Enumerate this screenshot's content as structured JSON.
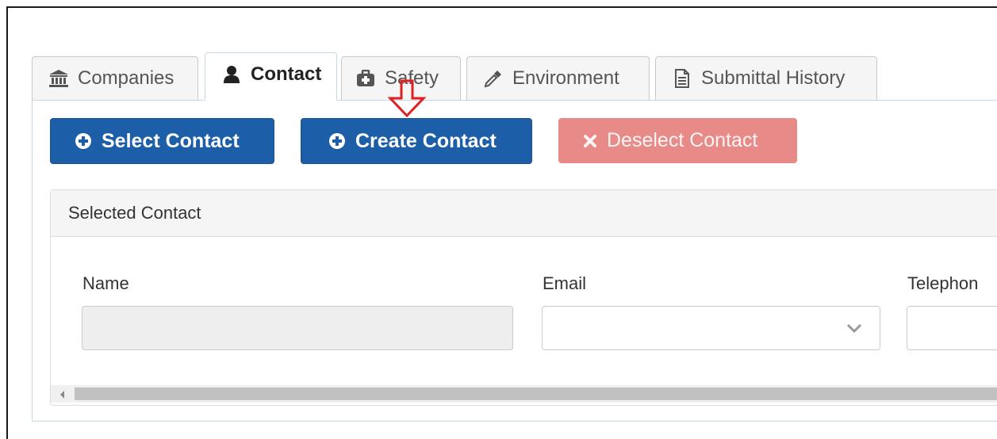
{
  "tabs": [
    {
      "label": "Companies",
      "icon": "bank-icon",
      "active": false
    },
    {
      "label": "Contact",
      "icon": "user-icon",
      "active": true
    },
    {
      "label": "Safety",
      "icon": "medkit-icon",
      "active": false
    },
    {
      "label": "Environment",
      "icon": "eyedropper-icon",
      "active": false
    },
    {
      "label": "Submittal History",
      "icon": "document-icon",
      "active": false
    }
  ],
  "buttons": {
    "select_contact": "Select Contact",
    "create_contact": "Create Contact",
    "deselect_contact": "Deselect Contact"
  },
  "section": {
    "title": "Selected Contact",
    "fields": {
      "name_label": "Name",
      "name_value": "",
      "email_label": "Email",
      "email_value": "",
      "telephone_label": "Telephon",
      "telephone_value": ""
    }
  },
  "annotation": {
    "icon": "red-down-arrow-icon",
    "color": "#e02020"
  },
  "colors": {
    "primary": "#1d5ea8",
    "danger": "#e88a87",
    "tab_border": "#c4d8e8"
  }
}
